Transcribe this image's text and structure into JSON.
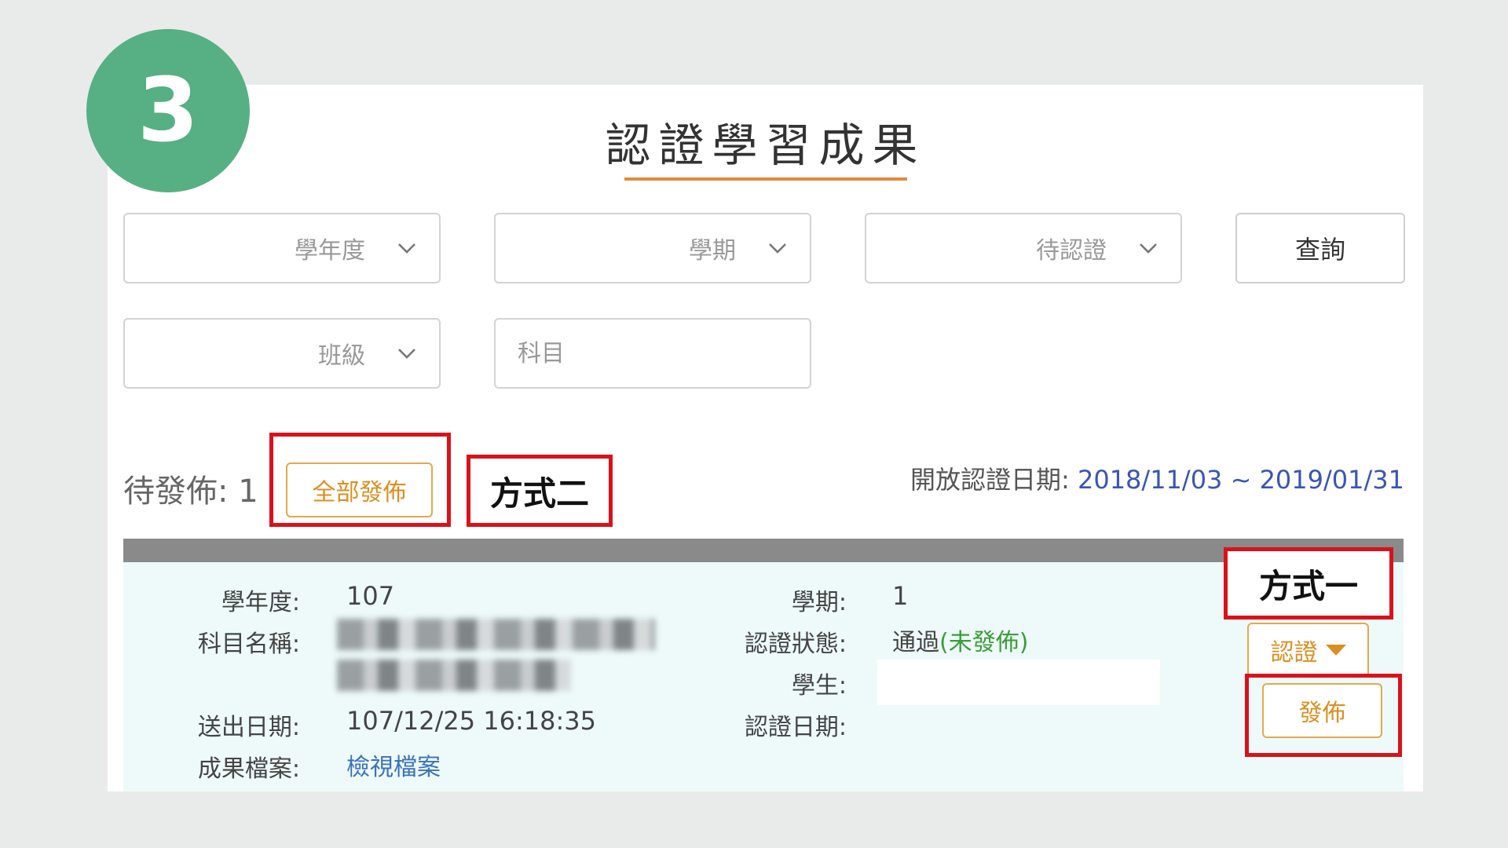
{
  "step_number": "3",
  "title": "認證學習成果",
  "filters": {
    "school_year": "學年度",
    "semester": "學期",
    "status": "待認證",
    "query_label": "查詢",
    "class": "班級",
    "subject_placeholder": "科目"
  },
  "pending": {
    "label": "待發佈: 1",
    "publish_all_label": "全部發佈",
    "method_two_label": "方式二"
  },
  "open_date": {
    "label": "開放認證日期:",
    "range": "2018/11/03 ~ 2019/01/31"
  },
  "record": {
    "school_year_label": "學年度:",
    "school_year_value": "107",
    "subject_label": "科目名稱:",
    "submit_date_label": "送出日期:",
    "submit_date_value": "107/12/25 16:18:35",
    "file_label": "成果檔案:",
    "file_link": "檢視檔案",
    "semester_label": "學期:",
    "semester_value": "1",
    "status_label": "認證狀態:",
    "status_value": "通過",
    "status_sub": "(未發佈)",
    "student_label": "學生:",
    "certify_date_label": "認證日期:",
    "method_one_label": "方式一",
    "certify_button": "認證",
    "publish_button": "發佈"
  },
  "colors": {
    "badge": "#56b083",
    "accent_orange": "#e28b38",
    "highlight_red": "#d9121b",
    "date_blue": "#3a55b4",
    "status_green": "#3b9c38",
    "link_blue": "#3a72b8",
    "record_bg": "#eefafa"
  },
  "icons": [
    "chevron-down-icon",
    "caret-down-icon"
  ]
}
